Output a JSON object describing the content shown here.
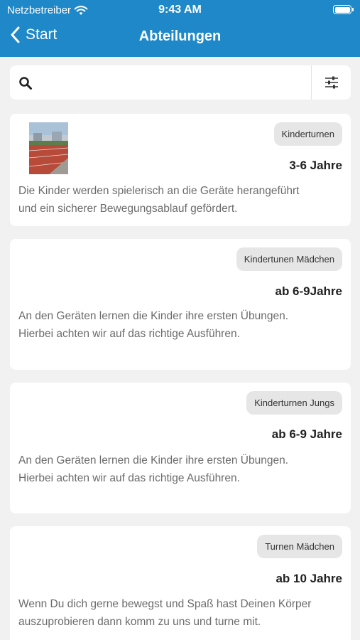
{
  "status": {
    "carrier": "Netzbetreiber",
    "time": "9:43 AM"
  },
  "nav": {
    "back_label": "Start",
    "title": "Abteilungen"
  },
  "search": {
    "value": "",
    "placeholder": ""
  },
  "colors": {
    "header": "#1e88c8",
    "background": "#f1f1f1",
    "badge": "#e6e6e6"
  },
  "icons": {
    "back": "chevron-left-icon",
    "search": "search-icon",
    "filter": "sliders-icon",
    "wifi": "wifi-icon",
    "battery": "battery-icon"
  },
  "cards": [
    {
      "badge": "Kinderturnen",
      "age": "3-6 Jahre",
      "description_lines": [
        "Die Kinder werden spielerisch an die Geräte herangeführt",
        "und ein sicherer Bewegungsablauf gefördert."
      ]
    },
    {
      "badge": "Kindertunen Mädchen",
      "age": "ab 6-9Jahre",
      "description_lines": [
        "An den Geräten lernen die Kinder ihre ersten Übungen.",
        "Hierbei achten wir auf das richtige Ausführen."
      ]
    },
    {
      "badge": "Kinderturnen Jungs",
      "age": "ab 6-9 Jahre",
      "description_lines": [
        "An den Geräten lernen die Kinder ihre ersten Übungen.",
        "Hierbei achten wir auf das richtige Ausführen."
      ]
    },
    {
      "badge": "Turnen Mädchen",
      "age": "ab 10 Jahre",
      "description_lines": [
        "Wenn Du dich gerne bewegst und Spaß hast Deinen Körper",
        "auszuprobieren dann komm zu uns und turne mit."
      ]
    }
  ]
}
